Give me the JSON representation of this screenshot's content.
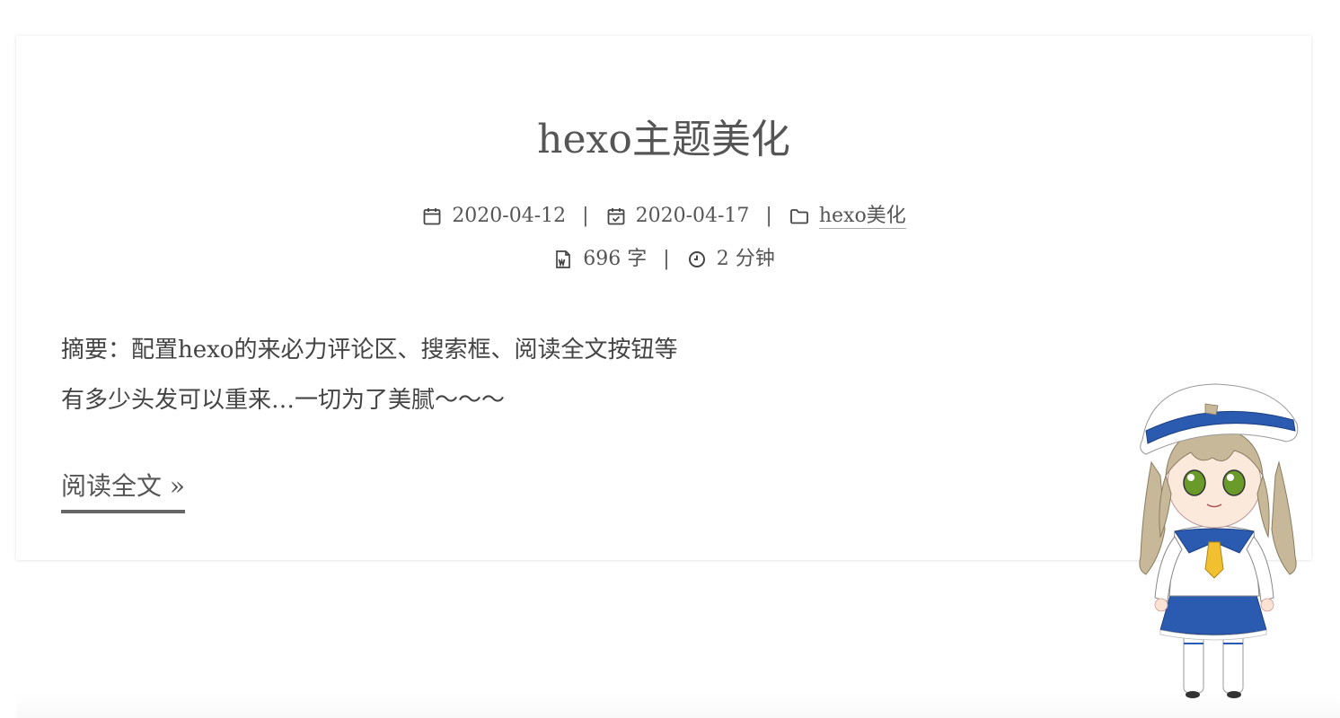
{
  "post": {
    "title": "hexo主题美化",
    "created_date": "2020-04-12",
    "updated_date": "2020-04-17",
    "category": "hexo美化",
    "word_count": "696 字",
    "read_time": "2 分钟",
    "separator": "|",
    "excerpt_lines": [
      "摘要：配置hexo的来必力评论区、搜索框、阅读全文按钮等",
      "有多少头发可以重来…一切为了美腻～～～"
    ],
    "read_more": "阅读全文 »"
  },
  "icons": {
    "created": "calendar-icon",
    "updated": "calendar-check-icon",
    "category": "folder-icon",
    "word_count": "file-word-icon",
    "read_time": "clock-icon"
  },
  "colors": {
    "text": "#555555",
    "underline": "#666666",
    "mascot_hair": "#c8b89a",
    "mascot_blue": "#2a5bb0",
    "mascot_tie": "#f0c030"
  }
}
